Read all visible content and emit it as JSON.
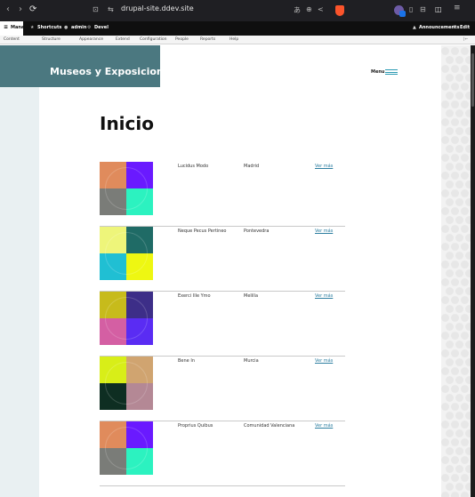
{
  "browser": {
    "back": "‹",
    "forward": "›",
    "reload": "⟳",
    "bookmark": "⊡",
    "site_settings": "⇆",
    "url": "drupal-site.ddev.site",
    "translate": "あ",
    "zoom": "⊕",
    "share": "<",
    "sidebar": "▯",
    "wallet": "⊟",
    "split": "◫",
    "menu": "≡"
  },
  "toolbar": {
    "manage": "Manage",
    "shortcuts": "Shortcuts",
    "user": "admin",
    "devel": "Devel",
    "announcements": "Announcements",
    "edit": "Edit"
  },
  "subtoolbar": {
    "items": [
      "Content",
      "Structure",
      "Appearance",
      "Extend",
      "Configuration",
      "People",
      "Reports",
      "Help"
    ]
  },
  "site": {
    "name": "Museos y Exposiciones",
    "menu_label": "Menu"
  },
  "page": {
    "title": "Inicio",
    "rows": [
      {
        "name": "Lucidus Modo",
        "place": "Madrid",
        "link": "Ver más",
        "colors": [
          "#e08b5c",
          "#6a1aff",
          "#7a7c78",
          "#2cf2c0"
        ]
      },
      {
        "name": "Neque Pecus Pertineo",
        "place": "Pontevedra",
        "link": "Ver más",
        "colors": [
          "#eef57a",
          "#1f6b66",
          "#20bfd3",
          "#eef712"
        ]
      },
      {
        "name": "Exerci Ille Ymo",
        "place": "Melilla",
        "link": "Ver más",
        "colors": [
          "#c7bb1b",
          "#3d2e88",
          "#d45fa3",
          "#5a2cf3"
        ]
      },
      {
        "name": "Bene In",
        "place": "Murcia",
        "link": "Ver más",
        "colors": [
          "#d8ee18",
          "#d0a470",
          "#0e2e22",
          "#b48895"
        ]
      },
      {
        "name": "Proprius Quibus",
        "place": "Comunidad Valenciana",
        "link": "Ver más",
        "colors": [
          "#e08b5c",
          "#6a1aff",
          "#7a7c78",
          "#2cf2c0"
        ]
      }
    ]
  },
  "colors": {
    "header": "#4b7880",
    "accent": "#2b9ab3",
    "link": "#2c7ea0"
  }
}
